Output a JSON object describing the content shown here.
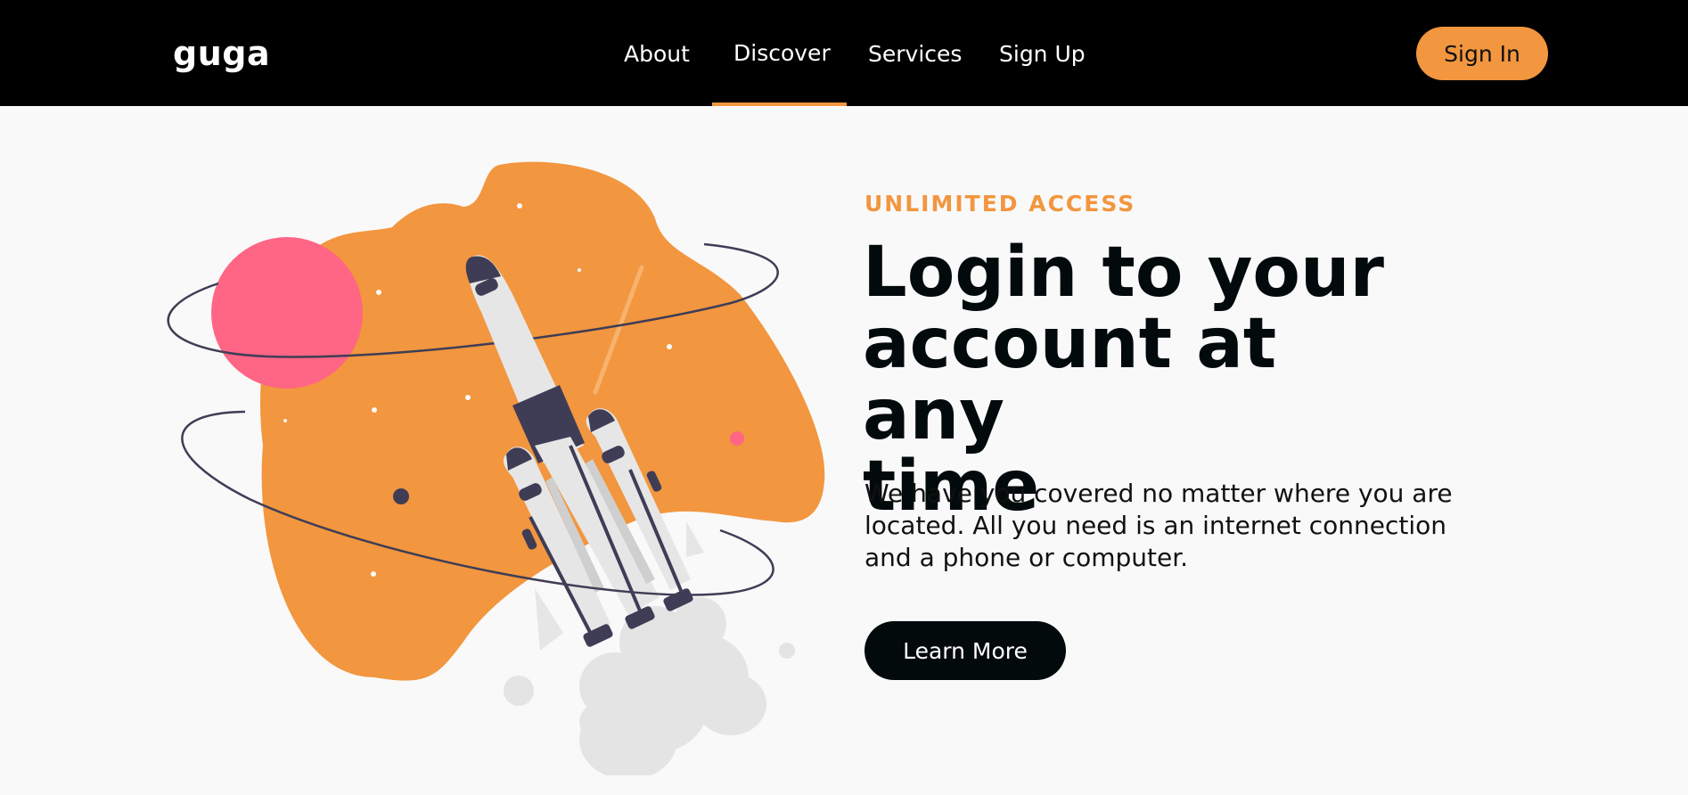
{
  "nav": {
    "logo": "guga",
    "links": [
      {
        "label": "About"
      },
      {
        "label": "Discover"
      },
      {
        "label": "Services"
      },
      {
        "label": "Sign Up"
      }
    ],
    "active_link": "Discover",
    "signin_label": "Sign In"
  },
  "hero": {
    "eyebrow": "UNLIMITED ACCESS",
    "headline_lines": [
      "Login to your",
      "account at any",
      "time"
    ],
    "description_lines": [
      "We have you covered no matter where you are",
      "located. All you need is an internet connection",
      "and a phone or computer."
    ],
    "cta_label": "Learn More"
  },
  "colors": {
    "accent": "#f2963f",
    "dark": "#030a0c",
    "planet_pink": "#ff6584",
    "rocket_dark": "#3f3d56",
    "background": "#f9f9f9"
  },
  "illustration": {
    "subject": "rocket-launch",
    "icons": [
      "planet-icon",
      "rocket-icon",
      "star-icon",
      "smoke-cloud-icon"
    ]
  }
}
